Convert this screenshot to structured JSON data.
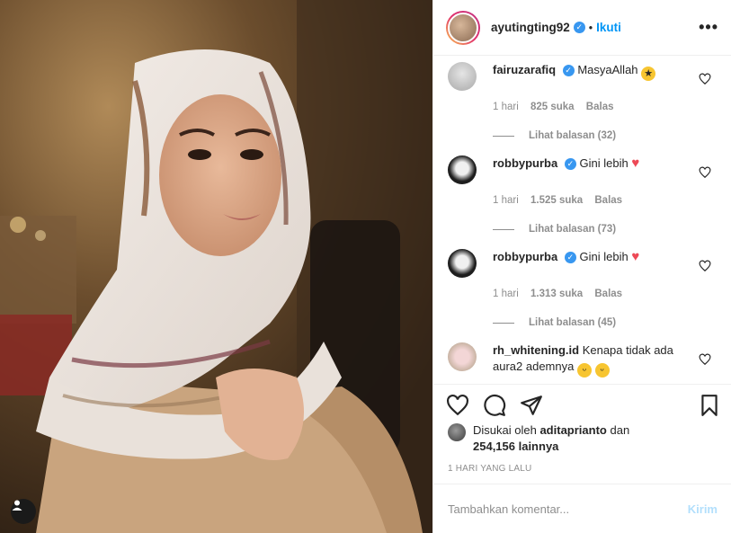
{
  "post": {
    "username": "ayutingting92",
    "follow_label": "Ikuti",
    "dot": "•",
    "more_label": "•••"
  },
  "comments": [
    {
      "username": "fairuzarafiq",
      "text": "MasyaAllah",
      "emoji": "star-struck-emoji",
      "time": "1 hari",
      "likes": "825 suka",
      "reply": "Balas",
      "view_replies": "Lihat balasan (32)"
    },
    {
      "username": "robbypurba",
      "text": "Gini lebih",
      "emoji": "red-heart-emoji",
      "time": "1 hari",
      "likes": "1.525 suka",
      "reply": "Balas",
      "view_replies": "Lihat balasan (73)"
    },
    {
      "username": "robbypurba",
      "text": "Gini lebih",
      "emoji": "red-heart-emoji",
      "time": "1 hari",
      "likes": "1.313 suka",
      "reply": "Balas",
      "view_replies": "Lihat balasan (45)"
    },
    {
      "username": "rh_whitening.id",
      "text": "Kenapa tidak ada aura2 ademnya",
      "emoji": "grinning-sweat-emoji"
    }
  ],
  "liked_by": {
    "prefix": "Disukai oleh",
    "user": "aditaprianto",
    "connector": "dan",
    "count": "254,156 lainnya"
  },
  "timestamp": "1 HARI YANG LALU",
  "add_comment": {
    "placeholder": "Tambahkan komentar...",
    "post_label": "Kirim"
  },
  "colors": {
    "accent": "#0095f6",
    "verified": "#3897f0",
    "heart": "#ed4956",
    "muted": "#8e8e8e",
    "post_disabled": "#b2dffc"
  }
}
